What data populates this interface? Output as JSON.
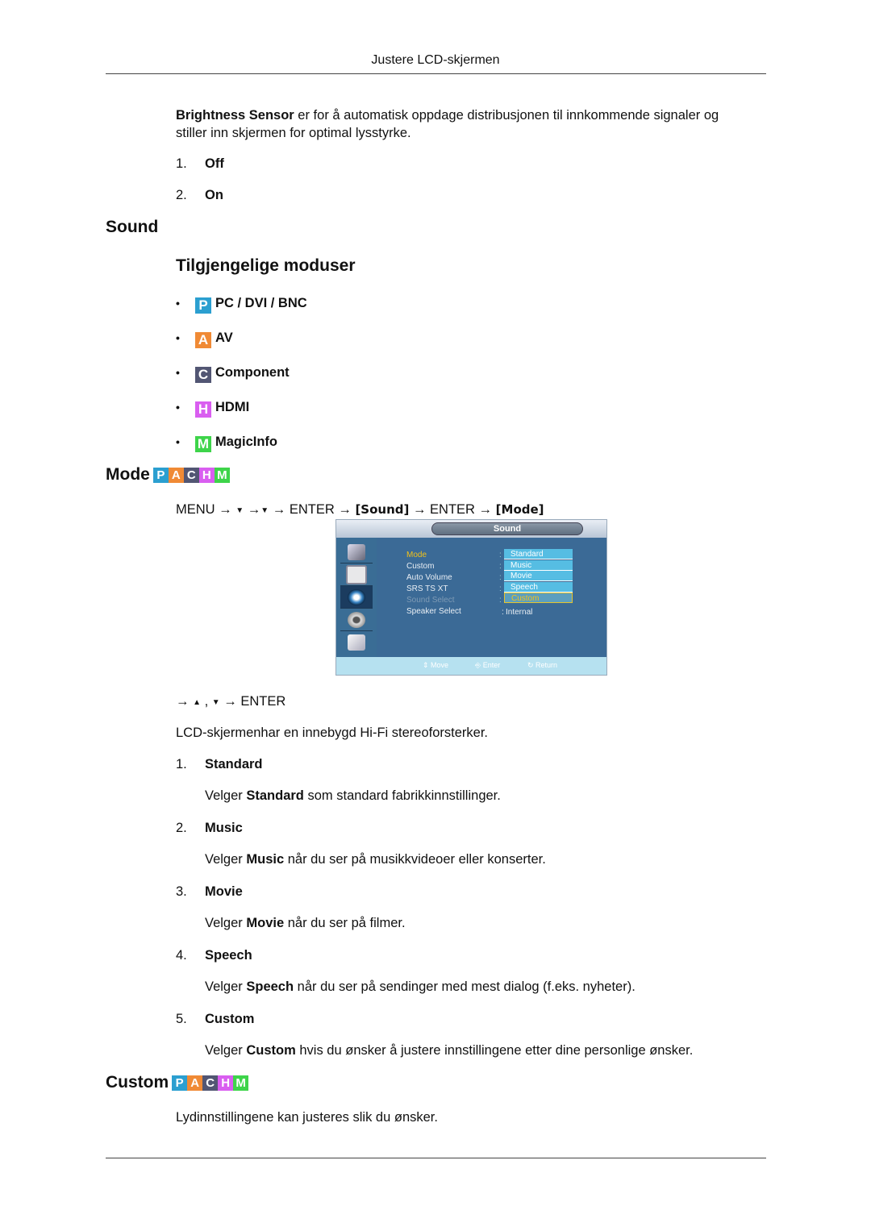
{
  "header": {
    "title": "Justere LCD-skjermen"
  },
  "intro": {
    "bold": "Brightness Sensor",
    "line1": " er for å automatisk oppdage distribusjonen til innkommende signaler og",
    "line2": "stiller inn skjermen for optimal lysstyrke."
  },
  "brightness_options": [
    {
      "num": "1.",
      "label": "Off"
    },
    {
      "num": "2.",
      "label": "On"
    }
  ],
  "sound_section": {
    "title": "Sound",
    "subtitle": "Tilgjengelige moduser",
    "modes": [
      {
        "letter": "P",
        "label": "PC / DVI / BNC",
        "color": "#2b9fd0"
      },
      {
        "letter": "A",
        "label": "AV",
        "color": "#f08a35"
      },
      {
        "letter": "C",
        "label": "Component",
        "color": "#525673"
      },
      {
        "letter": "H",
        "label": "HDMI",
        "color": "#d95ef0"
      },
      {
        "letter": "M",
        "label": "MagicInfo",
        "color": "#3ed44a"
      }
    ],
    "bullet": "•"
  },
  "pachm": {
    "letters": [
      "P",
      "A",
      "C",
      "H",
      "M"
    ],
    "colors": [
      "#2b9fd0",
      "#f08a35",
      "#525673",
      "#d95ef0",
      "#3ed44a"
    ]
  },
  "mode_section": {
    "title": "Mode",
    "nav_path": {
      "menu": "MENU →",
      "down1": "▼",
      "arrow2": " →",
      "down2": "▼",
      "enter1": " → ENTER →",
      "sound": "[Sound]",
      "enter2": " → ENTER →",
      "mode": "[Mode]"
    },
    "nav_after": {
      "arrow": "→",
      "up": "▲",
      "comma": " , ",
      "down": "▼",
      "enter": "→ ENTER"
    },
    "description": "LCD-skjermenhar en innebygd Hi-Fi stereoforsterker.",
    "options": [
      {
        "num": "1.",
        "label": "Standard",
        "pre": "Velger ",
        "bold": "Standard",
        "post": " som standard fabrikkinnstillinger."
      },
      {
        "num": "2.",
        "label": "Music",
        "pre": "Velger ",
        "bold": "Music",
        "post": " når du ser på musikkvideoer eller konserter."
      },
      {
        "num": "3.",
        "label": "Movie",
        "pre": "Velger ",
        "bold": "Movie",
        "post": " når du ser på filmer."
      },
      {
        "num": "4.",
        "label": "Speech",
        "pre": "Velger ",
        "bold": "Speech",
        "post": " når du ser på sendinger med mest dialog (f.eks. nyheter)."
      },
      {
        "num": "5.",
        "label": "Custom",
        "pre": "Velger ",
        "bold": "Custom",
        "post": " hvis du ønsker å justere innstillingene etter dine personlige ønsker."
      }
    ]
  },
  "osd": {
    "title": "Sound",
    "side_icons": [
      "input-icon",
      "picture-icon",
      "sound-icon",
      "setup-icon",
      "multi-control-icon"
    ],
    "menu_items": [
      {
        "label": "Mode",
        "state": "active",
        "color": "#f2c21a"
      },
      {
        "label": "Custom",
        "state": "normal",
        "color": "#e8eef4"
      },
      {
        "label": "Auto Volume",
        "state": "normal",
        "color": "#e8eef4"
      },
      {
        "label": "SRS TS XT",
        "state": "normal",
        "color": "#e8eef4"
      },
      {
        "label": "Sound Select",
        "state": "disabled",
        "color": "#7f9bb5"
      },
      {
        "label": "Speaker Select",
        "state": "normal",
        "color": "#e8eef4"
      }
    ],
    "colon": ":",
    "speaker_value": "Internal",
    "dropdown": [
      "Standard",
      "Music",
      "Movie",
      "Speech",
      "Custom"
    ],
    "dropdown_selected": "Custom",
    "footer": {
      "move": "⇕ Move",
      "enter": "Enter",
      "return": "Return"
    }
  },
  "custom_section": {
    "title": "Custom",
    "description": "Lydinnstillingene kan justeres slik du ønsker."
  }
}
